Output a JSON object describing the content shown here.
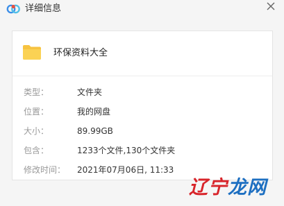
{
  "window": {
    "title": "详细信息"
  },
  "colors": {
    "background": "#f5f5f5",
    "panel": "#ffffff",
    "label": "#999999",
    "value": "#333333",
    "folder_yellow": "#f7c341",
    "logo_blue": "#3d8fe8",
    "watermark_red": "#d8242a",
    "watermark_blue": "#1d6fc1"
  },
  "icons": {
    "app_logo": "baidu-netdisk-cloud-icon",
    "close": "close-icon",
    "folder": "folder-icon"
  },
  "folder": {
    "name": "环保资料大全"
  },
  "details": [
    {
      "label": "类型：",
      "value": "文件夹"
    },
    {
      "label": "位置：",
      "value": "我的网盘"
    },
    {
      "label": "大小：",
      "value": "89.99GB"
    },
    {
      "label": "包含：",
      "value": "1233个文件,130个文件夹"
    },
    {
      "label": "修改时间：",
      "value": "2021年07月06日, 11:33"
    }
  ],
  "watermark": {
    "part1": "辽宁",
    "part2": "龙网"
  }
}
